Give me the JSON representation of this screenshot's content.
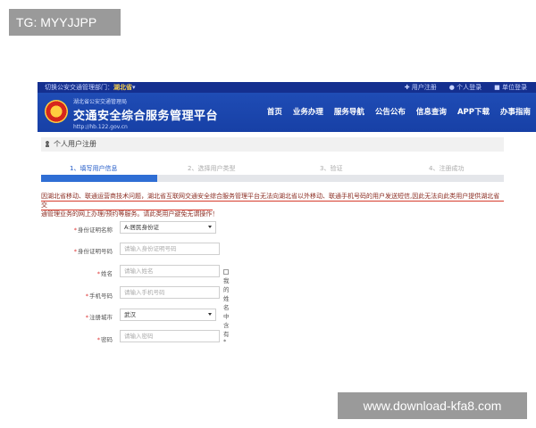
{
  "watermarks": {
    "top": "TG: MYYJJPP",
    "bottom": "www.download-kfa8.com"
  },
  "topbar": {
    "switch_text": "切换公安交通管理部门：",
    "region": "湖北省",
    "links": [
      "用户注册",
      "个人登录",
      "单位登录"
    ]
  },
  "header": {
    "org": "湖北省公安交通管理局",
    "title": "交通安全综合服务管理平台",
    "url": "http://hb.122.gov.cn",
    "nav": [
      "首页",
      "业务办理",
      "服务导航",
      "公告公布",
      "信息查询",
      "APP下载",
      "办事指南"
    ]
  },
  "breadcrumb": {
    "label": "个人用户注册"
  },
  "steps": [
    {
      "label": "1、填写用户信息",
      "active": true
    },
    {
      "label": "2、选择用户类型",
      "active": false
    },
    {
      "label": "3、验证",
      "active": false
    },
    {
      "label": "4、注册成功",
      "active": false
    }
  ],
  "progress": {
    "fraction": 0.25
  },
  "notice": {
    "line1": "因湖北省移动、联通运营商技术问题，湖北省互联网交通安全综合服务管理平台无法向湖北省以外移动、联通手机号码的用户发送短信,因此无法向此类用户提供湖北省交",
    "line2": "通管理业务的网上办理/预约等服务。请此类用户避免无谓操作！"
  },
  "form": {
    "id_type": {
      "label": "身份证明名称",
      "value": "A:居民身份证"
    },
    "id_number": {
      "label": "身份证明号码",
      "placeholder": "请输入身份证明号码"
    },
    "name": {
      "label": "姓名",
      "placeholder": "请输入姓名",
      "rare_char": "我的姓名中含有*"
    },
    "phone": {
      "label": "手机号码",
      "placeholder": "请输入手机号码"
    },
    "city": {
      "label": "注册城市",
      "value": "武汉"
    },
    "password": {
      "label": "密码",
      "placeholder": "请输入密码"
    }
  },
  "colors": {
    "header_blue": "#1f4cb5",
    "topbar_blue": "#142f8f",
    "notice_red": "#d63a2c",
    "progress_blue": "#2f6ed4"
  }
}
